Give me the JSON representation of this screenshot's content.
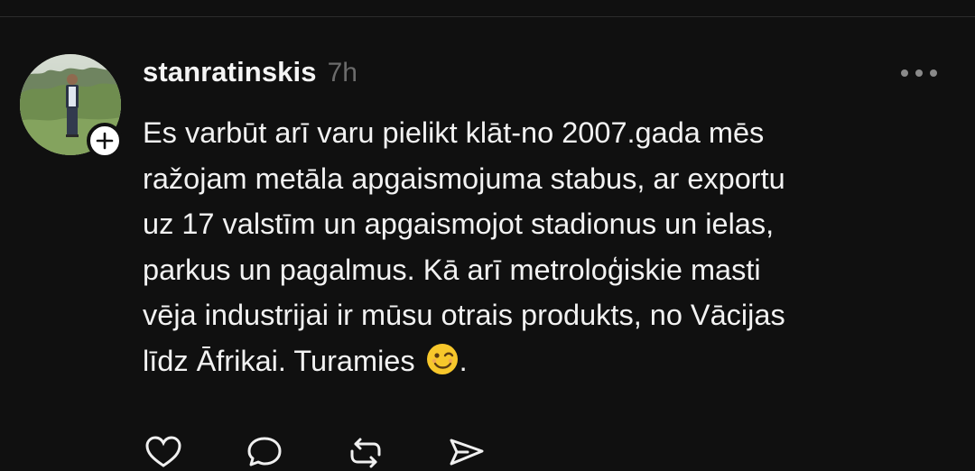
{
  "post": {
    "username": "stanratinskis",
    "timestamp": "7h",
    "text_before_emoji": "Es varbūt arī varu pielikt klāt-no 2007.gada mēs\nražojam metāla apgaismojuma stabus, ar exportu\nuz 17 valstīm un apgaismojot stadionus un ielas,\nparkus un pagalmus. Kā arī metroloģiskie masti\nvēja industrijai ir mūsu otrais produkts, no Vācijas\nlīdz Āfrikai. Turamies ",
    "text_after_emoji": ".",
    "emoji": "winking-face-emoji"
  },
  "icons": {
    "avatar": "user-avatar-photo",
    "follow": "plus-icon",
    "more": "more-horizontal-icon",
    "like": "heart-icon",
    "comment": "comment-icon",
    "repost": "repost-icon",
    "share": "send-icon"
  },
  "colors": {
    "background": "#101010",
    "text": "#f2f2f2",
    "muted": "#6b6b6b",
    "emoji": "#f7c72b"
  }
}
